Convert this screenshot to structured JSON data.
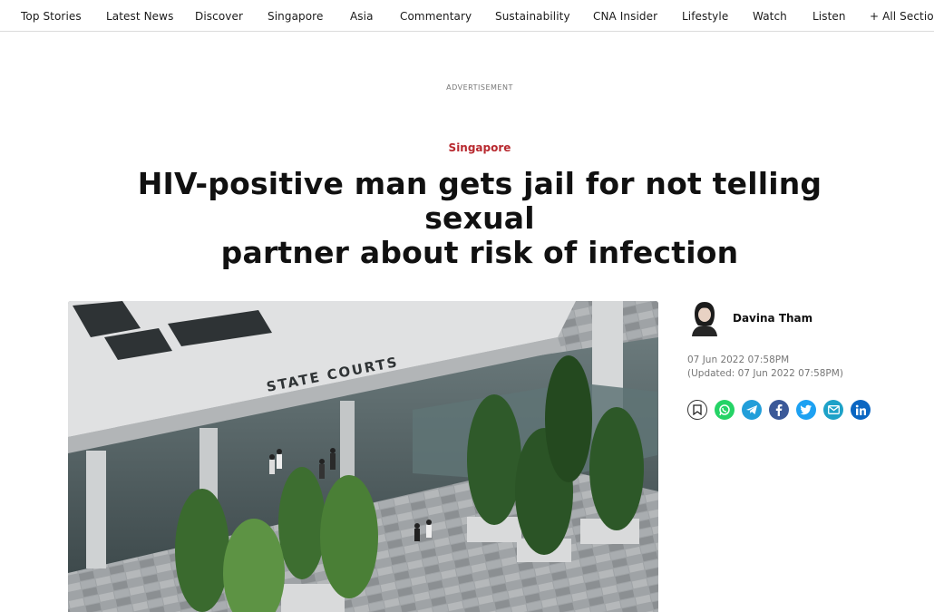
{
  "nav": {
    "items": [
      "Top Stories",
      "Latest News",
      "Discover",
      "Singapore",
      "Asia",
      "Commentary",
      "Sustainability",
      "CNA Insider",
      "Lifestyle",
      "Watch",
      "Listen",
      "+ All Sections"
    ]
  },
  "advertisement_label": "ADVERTISEMENT",
  "article": {
    "category": "Singapore",
    "headline_line1": "HIV-positive man gets jail for not telling sexual",
    "headline_line2": "partner about risk of infection",
    "hero_image_sign": "STATE COURTS"
  },
  "author": {
    "name": "Davina Tham",
    "published": "07 Jun 2022 07:58PM",
    "updated": "(Updated: 07 Jun 2022 07:58PM)"
  },
  "share": [
    {
      "name": "bookmark-icon",
      "color": "#ffffff"
    },
    {
      "name": "whatsapp-icon",
      "color": "#25d366"
    },
    {
      "name": "telegram-icon",
      "color": "#229ed9"
    },
    {
      "name": "facebook-icon",
      "color": "#3b5998"
    },
    {
      "name": "twitter-icon",
      "color": "#1da1f2"
    },
    {
      "name": "email-icon",
      "color": "#1ea2c8"
    },
    {
      "name": "linkedin-icon",
      "color": "#0a66c2"
    }
  ],
  "colors": {
    "accent": "#b8292f"
  }
}
